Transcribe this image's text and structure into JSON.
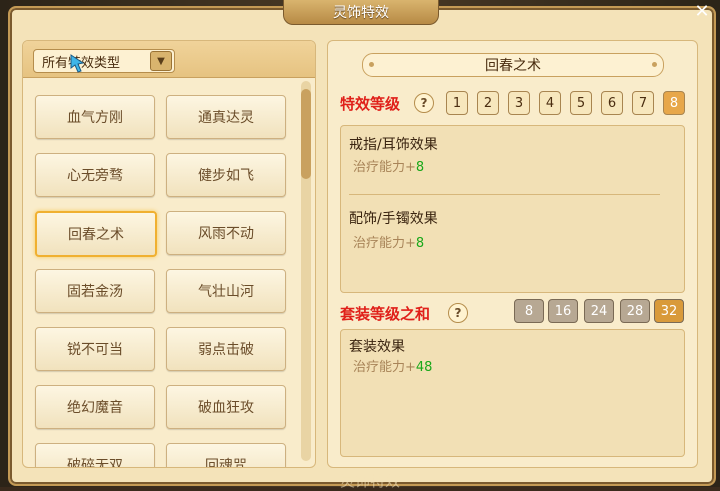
{
  "window": {
    "title": "灵饰特效",
    "close_label": "✕"
  },
  "left": {
    "type_select": "所有特效类型",
    "buttons": [
      "血气方刚",
      "通真达灵",
      "心无旁骛",
      "健步如飞",
      "回春之术",
      "风雨不动",
      "固若金汤",
      "气壮山河",
      "锐不可当",
      "弱点击破",
      "绝幻魔音",
      "破血狂攻",
      "破碎无双",
      "回魂咒"
    ],
    "active_index": 4
  },
  "right": {
    "effect_name": "回春之术",
    "level_label": "特效等级",
    "levels": [
      "1",
      "2",
      "3",
      "4",
      "5",
      "6",
      "7",
      "8"
    ],
    "active_level": 7,
    "help": "?",
    "box1": {
      "h1": "戒指/耳饰效果",
      "v1_label": "治疗能力+",
      "v1_value": "8",
      "h2": "配饰/手镯效果",
      "v2_label": "治疗能力+",
      "v2_value": "8"
    },
    "sum_label": "套装等级之和",
    "sums": [
      "8",
      "16",
      "24",
      "28",
      "32"
    ],
    "active_sum": 4,
    "box2": {
      "h1": "套装效果",
      "v1_label": "治疗能力+",
      "v1_value": "48"
    }
  },
  "bottom": {
    "tab": "灵饰特效"
  }
}
